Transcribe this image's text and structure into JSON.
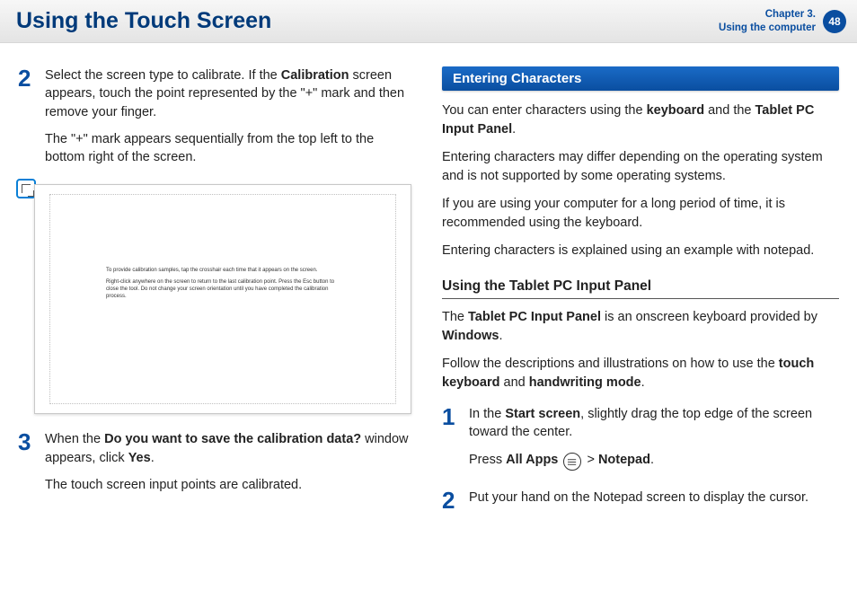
{
  "header": {
    "title": "Using the Touch Screen",
    "chapter_line1": "Chapter 3.",
    "chapter_line2": "Using the computer",
    "page_number": "48"
  },
  "left": {
    "step2": {
      "num": "2",
      "p1_a": "Select the screen type to calibrate. If the ",
      "p1_b_bold": "Calibration",
      "p1_c": " screen appears, touch the point represented by the \"+\" mark and then remove your finger.",
      "p2": "The \"+\" mark appears sequentially from the top left to the bottom right of the screen."
    },
    "calib_img": {
      "line1": "To provide calibration samples, tap the crosshair each time that it appears on the screen.",
      "line2": "Right-click anywhere on the screen to return to the last calibration point. Press the Esc button to close the tool. Do not change your screen orientation until you have completed the calibration process."
    },
    "step3": {
      "num": "3",
      "p1_a": "When the ",
      "p1_b_bold": "Do you want to save the calibration data?",
      "p1_c": " window appears, click ",
      "p1_d_bold": "Yes",
      "p1_e": ".",
      "p2": "The touch screen input points are calibrated."
    }
  },
  "right": {
    "section_title": "Entering Characters",
    "p1_a": "You can enter characters using the ",
    "p1_b_bold": "keyboard",
    "p1_c": " and the ",
    "p1_d_bold": "Tablet PC Input Panel",
    "p1_e": ".",
    "p2": "Entering characters may differ depending on the operating system and is not supported by some operating systems.",
    "p3": "If you are using your computer for a long period of time, it is recommended using the keyboard.",
    "p4": "Entering characters is explained using an example with notepad.",
    "subhead": "Using the Tablet PC Input Panel",
    "sp1_a": "The ",
    "sp1_b_bold": "Tablet PC Input Panel",
    "sp1_c": " is an onscreen keyboard provided by ",
    "sp1_d_bold": "Windows",
    "sp1_e": ".",
    "sp2_a": "Follow the descriptions and illustrations on how to use the ",
    "sp2_b_bold": "touch keyboard",
    "sp2_c": " and ",
    "sp2_d_bold": "handwriting mode",
    "sp2_e": ".",
    "step1": {
      "num": "1",
      "p1_a": "In the ",
      "p1_b_bold": "Start screen",
      "p1_c": ", slightly drag the top edge of the screen toward the center.",
      "p2_a": "Press ",
      "p2_b_bold": "All Apps",
      "p2_c": " > ",
      "p2_d_bold": "Notepad",
      "p2_e": "."
    },
    "step2": {
      "num": "2",
      "p1": "Put your hand on the Notepad screen to display the cursor."
    }
  }
}
